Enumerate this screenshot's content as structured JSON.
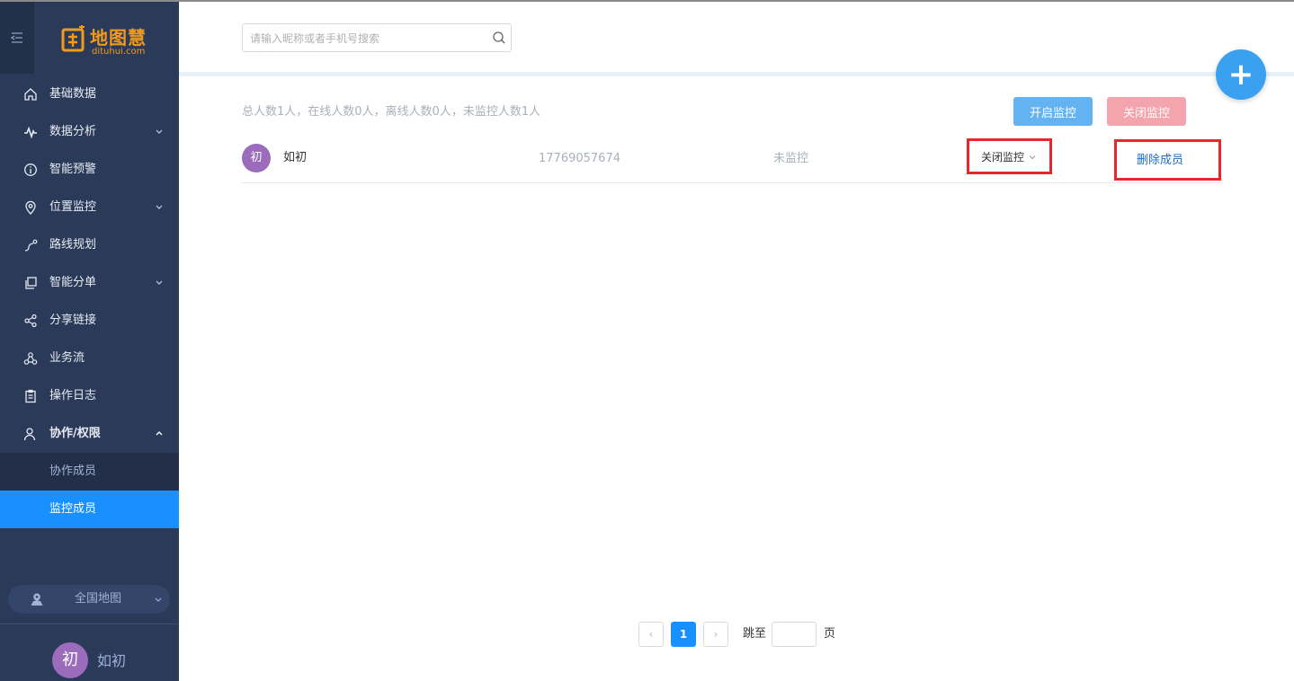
{
  "sidebar": {
    "logo": {
      "title": "地图慧",
      "subtitle": "dituhui.com"
    },
    "menu": [
      {
        "label": "基础数据",
        "icon": "home-icon",
        "expandable": false
      },
      {
        "label": "数据分析",
        "icon": "trend-icon",
        "expandable": true
      },
      {
        "label": "智能预警",
        "icon": "info-circle-icon",
        "expandable": false
      },
      {
        "label": "位置监控",
        "icon": "location-pin-icon",
        "expandable": true
      },
      {
        "label": "路线规划",
        "icon": "route-icon",
        "expandable": false
      },
      {
        "label": "智能分单",
        "icon": "copy-icon",
        "expandable": true
      },
      {
        "label": "分享链接",
        "icon": "share-icon",
        "expandable": false
      },
      {
        "label": "业务流",
        "icon": "workflow-icon",
        "expandable": false
      },
      {
        "label": "操作日志",
        "icon": "clipboard-icon",
        "expandable": false
      },
      {
        "label": "协作/权限",
        "icon": "user-icon",
        "expandable": true,
        "expanded": true
      }
    ],
    "submenu": [
      {
        "label": "协作成员",
        "active": false
      },
      {
        "label": "监控成员",
        "active": true
      }
    ],
    "region": {
      "label": "全国地图"
    },
    "user": {
      "avatar_text": "初",
      "name": "如初"
    }
  },
  "search": {
    "placeholder": "请输入昵称或者手机号搜索",
    "value": ""
  },
  "summary": "总人数1人，在线人数0人，离线人数0人，未监控人数1人",
  "toolbar": {
    "open_label": "开启监控",
    "close_label": "关闭监控"
  },
  "members": [
    {
      "avatar_text": "初",
      "name": "如初",
      "phone": "17769057674",
      "status": "未监控",
      "action": "关闭监控",
      "delete_label": "删除成员"
    }
  ],
  "pagination": {
    "current": "1",
    "prev": "‹",
    "next": "›",
    "jump_label": "跳至",
    "page_suffix": "页"
  },
  "colors": {
    "sidebar_bg": "#2b3a58",
    "active_blue": "#1890ff",
    "logo_orange": "#f39a1d",
    "open_btn": "#63b3f2",
    "close_btn": "#f4a4ac",
    "highlight_red": "#e8262b",
    "avatar_purple": "#9c6cbc"
  }
}
